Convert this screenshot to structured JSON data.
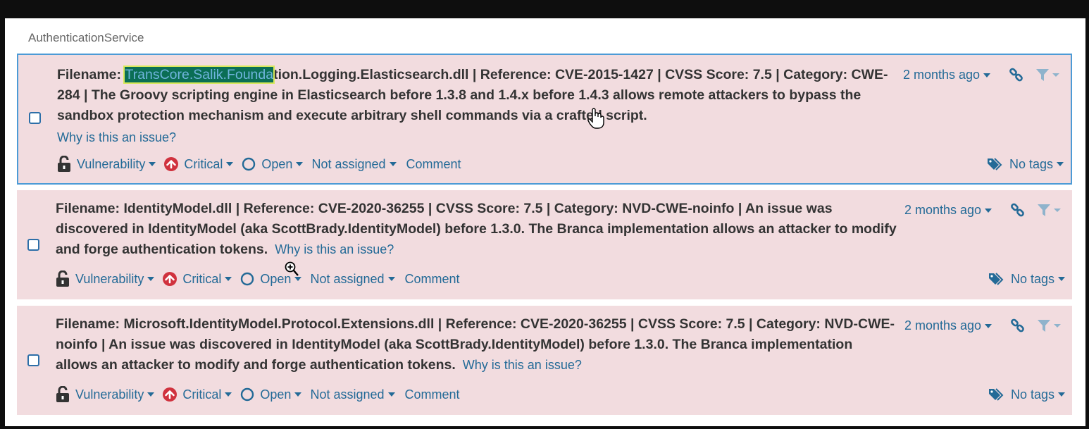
{
  "component": {
    "name": "AuthenticationService"
  },
  "common": {
    "type_label": "Vulnerability",
    "severity_label": "Critical",
    "status_label": "Open",
    "assignee_label": "Not assigned",
    "comment_label": "Comment",
    "tags_label": "No tags",
    "why_label": "Why is this an issue?",
    "date_label": "2 months ago"
  },
  "issues": [
    {
      "msg_prefix": "Filename: ",
      "msg_highlight": "TransCore.Salik.Founda",
      "msg_rest": "tion.Logging.Elasticsearch.dll | Reference: CVE-2015-1427 | CVSS Score: 7.5 | Category: CWE-284 | The Groovy scripting engine in Elasticsearch before 1.3.8 and 1.4.x before 1.4.3 allows remote attackers to bypass the sandbox protection mechanism and execute arbitrary shell commands via a crafted script."
    },
    {
      "message": "Filename: IdentityModel.dll | Reference: CVE-2020-36255 | CVSS Score: 7.5 | Category: NVD-CWE-noinfo | An issue was discovered in IdentityModel (aka ScottBrady.IdentityModel) before 1.3.0. The Branca implementation allows an attacker to modify and forge authentication tokens."
    },
    {
      "message": "Filename: Microsoft.IdentityModel.Protocol.Extensions.dll | Reference: CVE-2020-36255 | CVSS Score: 7.5 | Category: NVD-CWE-noinfo | An issue was discovered in IdentityModel (aka ScottBrady.IdentityModel) before 1.3.0. The Branca implementation allows an attacker to modify and forge authentication tokens."
    }
  ],
  "colors": {
    "card_bg": "#f2dcdf",
    "link": "#236a97",
    "critical": "#d0323e",
    "selection_border": "#4c9bd6"
  },
  "icons": {
    "type": "unlock-icon",
    "severity": "arrow-up-circle-icon",
    "status": "circle-outline-icon",
    "permalink": "link-icon",
    "filter": "filter-icon",
    "tags": "tags-icon"
  }
}
